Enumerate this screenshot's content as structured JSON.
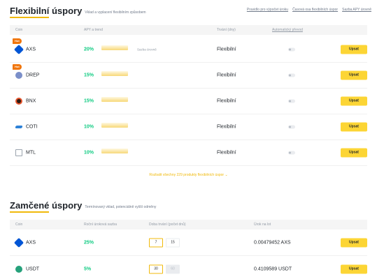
{
  "flexible": {
    "title": "Flexibilní úspory",
    "subtitle": "Vklad a vyplacení flexibilním způsobem",
    "links": [
      "Pravidlo pro výpočet úroku",
      "Časová osa flexibilních úspor",
      "Sazba APY úrovně"
    ],
    "headers": {
      "coin": "Coin",
      "apy": "APY a trend",
      "term": "Trvání (dny)",
      "auto": "Automatický převod"
    },
    "estimate_label": "Sazba úrovně",
    "rows": [
      {
        "coin": "AXS",
        "apy": "20%",
        "term": "Flexibilní",
        "button": "Upsat",
        "hot": "Hot",
        "icon": "axs-icon",
        "color": "#0055d5"
      },
      {
        "coin": "DREP",
        "apy": "15%",
        "term": "Flexibilní",
        "button": "Upsat",
        "hot": "Hot",
        "icon": "drep-icon",
        "color": "#7b8fc9"
      },
      {
        "coin": "BNX",
        "apy": "15%",
        "term": "Flexibilní",
        "button": "Upsat",
        "hot": "",
        "icon": "bnx-icon",
        "color": "#2b1a12"
      },
      {
        "coin": "COTI",
        "apy": "10%",
        "term": "Flexibilní",
        "button": "Upsat",
        "hot": "",
        "icon": "coti-icon",
        "color": "#2d81d7"
      },
      {
        "coin": "MTL",
        "apy": "10%",
        "term": "Flexibilní",
        "button": "Upsat",
        "hot": "",
        "icon": "mtl-icon",
        "color": "#9aa3ad"
      }
    ],
    "show_more": "Rozbalit všechny 229 produkty flexibilních úspor"
  },
  "locked": {
    "title": "Zamčené úspory",
    "subtitle": "Termínovaný vklad, potenciálně vyšší odměny",
    "headers": {
      "coin": "Coin",
      "rate": "Roční úroková sazba",
      "duration": "Doba trvání (počet dnů)",
      "interest": "Úrok na lot"
    },
    "rows": [
      {
        "coin": "AXS",
        "rate": "25%",
        "durations": [
          "7",
          "15"
        ],
        "selected": 0,
        "interest": "0.00479452 AXS",
        "button": "Upsat",
        "icon": "axs-icon",
        "color": "#0055d5"
      },
      {
        "coin": "USDT",
        "rate": "5%",
        "durations": [
          "30",
          "60"
        ],
        "selected": 0,
        "interest": "0.4109589 USDT",
        "button": "Upsat",
        "icon": "usdt-icon",
        "color": "#26a17b"
      }
    ]
  }
}
